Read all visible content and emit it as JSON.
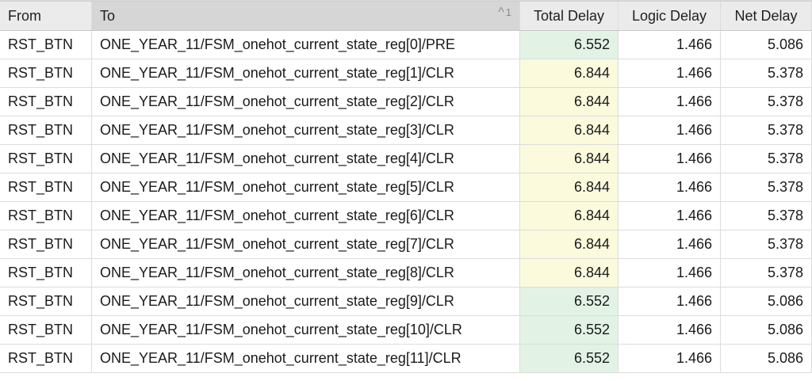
{
  "colors": {
    "green_cell": "#e2f3e6",
    "yellow_cell": "#fbfadd",
    "header_bg": "#ebebeb",
    "sorted_header_bg": "#d6d6d6"
  },
  "header": {
    "from": "From",
    "to": "To",
    "sort_order": "1",
    "total": "Total Delay",
    "logic": "Logic Delay",
    "net": "Net Delay"
  },
  "rows": [
    {
      "from": "RST_BTN",
      "to": "ONE_YEAR_11/FSM_onehot_current_state_reg[0]/PRE",
      "total": "6.552",
      "logic": "1.466",
      "net": "5.086",
      "highlight": "green"
    },
    {
      "from": "RST_BTN",
      "to": "ONE_YEAR_11/FSM_onehot_current_state_reg[1]/CLR",
      "total": "6.844",
      "logic": "1.466",
      "net": "5.378",
      "highlight": "yellow"
    },
    {
      "from": "RST_BTN",
      "to": "ONE_YEAR_11/FSM_onehot_current_state_reg[2]/CLR",
      "total": "6.844",
      "logic": "1.466",
      "net": "5.378",
      "highlight": "yellow"
    },
    {
      "from": "RST_BTN",
      "to": "ONE_YEAR_11/FSM_onehot_current_state_reg[3]/CLR",
      "total": "6.844",
      "logic": "1.466",
      "net": "5.378",
      "highlight": "yellow"
    },
    {
      "from": "RST_BTN",
      "to": "ONE_YEAR_11/FSM_onehot_current_state_reg[4]/CLR",
      "total": "6.844",
      "logic": "1.466",
      "net": "5.378",
      "highlight": "yellow"
    },
    {
      "from": "RST_BTN",
      "to": "ONE_YEAR_11/FSM_onehot_current_state_reg[5]/CLR",
      "total": "6.844",
      "logic": "1.466",
      "net": "5.378",
      "highlight": "yellow"
    },
    {
      "from": "RST_BTN",
      "to": "ONE_YEAR_11/FSM_onehot_current_state_reg[6]/CLR",
      "total": "6.844",
      "logic": "1.466",
      "net": "5.378",
      "highlight": "yellow"
    },
    {
      "from": "RST_BTN",
      "to": "ONE_YEAR_11/FSM_onehot_current_state_reg[7]/CLR",
      "total": "6.844",
      "logic": "1.466",
      "net": "5.378",
      "highlight": "yellow"
    },
    {
      "from": "RST_BTN",
      "to": "ONE_YEAR_11/FSM_onehot_current_state_reg[8]/CLR",
      "total": "6.844",
      "logic": "1.466",
      "net": "5.378",
      "highlight": "yellow"
    },
    {
      "from": "RST_BTN",
      "to": "ONE_YEAR_11/FSM_onehot_current_state_reg[9]/CLR",
      "total": "6.552",
      "logic": "1.466",
      "net": "5.086",
      "highlight": "green"
    },
    {
      "from": "RST_BTN",
      "to": "ONE_YEAR_11/FSM_onehot_current_state_reg[10]/CLR",
      "total": "6.552",
      "logic": "1.466",
      "net": "5.086",
      "highlight": "green"
    },
    {
      "from": "RST_BTN",
      "to": "ONE_YEAR_11/FSM_onehot_current_state_reg[11]/CLR",
      "total": "6.552",
      "logic": "1.466",
      "net": "5.086",
      "highlight": "green"
    }
  ]
}
